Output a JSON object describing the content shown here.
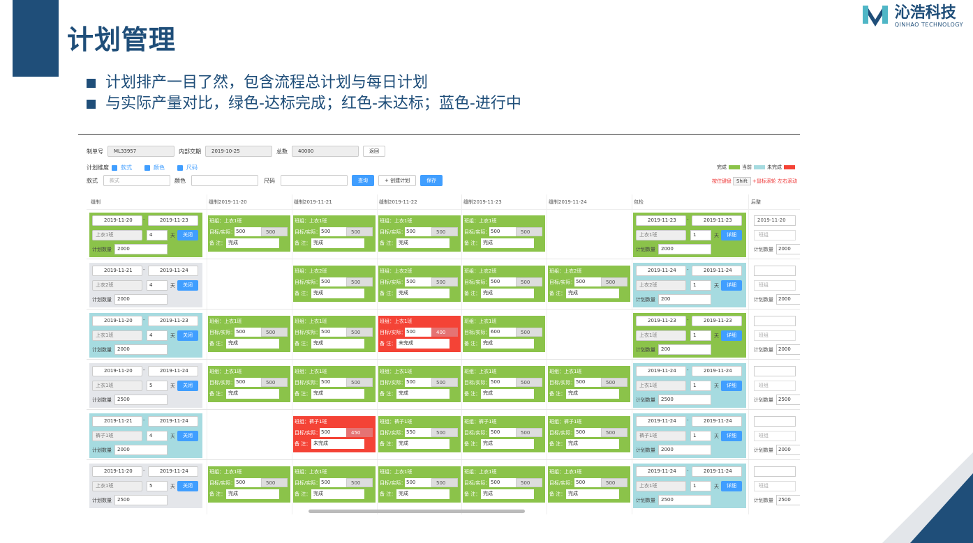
{
  "slide": {
    "title": "计划管理",
    "bullets": [
      "计划排产一目了然，包含流程总计划与每日计划",
      "与实际产量对比，绿色-达标完成；红色-未达标；蓝色-进行中"
    ],
    "logo_cn": "沁浩科技",
    "logo_en": "QINHAO TECHNOLOGY",
    "colors": {
      "brand": "#1f4e79",
      "green": "#8bc34a",
      "red": "#f44336",
      "blue": "#a6dbe0"
    }
  },
  "form": {
    "order_label": "制单号",
    "order_value": "ML33957",
    "delivery_label": "内部交期",
    "delivery_value": "2019-10-25",
    "total_label": "总数",
    "total_value": "40000",
    "back_button": "返回",
    "dim_label": "计划维度",
    "dim_style": "款式",
    "dim_color": "颜色",
    "dim_size": "尺码",
    "style_label": "款式",
    "style_placeholder": "款式",
    "color_label": "颜色",
    "size_label": "尺码",
    "query_button": "查询",
    "create_button": "+ 创建计划",
    "save_button": "保存"
  },
  "legend": {
    "done": "完成",
    "current": "当前",
    "undone": "未完成"
  },
  "hint": {
    "pre": "按住键盘",
    "key": "Shift",
    "post": "+鼠标滚轮 左右滚动"
  },
  "columns": [
    "缝制",
    "缝制2019-11-20",
    "缝制2019-11-21",
    "缝制2019-11-22",
    "缝制2019-11-23",
    "缝制2019-11-24",
    "包检",
    "后整"
  ],
  "labels": {
    "group": "班组：",
    "target": "目标/实际：",
    "note": "备 注：",
    "qty": "计划数量",
    "day": "天",
    "close": "关闭",
    "detail": "详细",
    "dash": "-",
    "back_group": "班组"
  },
  "rows": [
    {
      "sew": {
        "from": "2019-11-20",
        "to": "2019-11-23",
        "group": "上衣1班",
        "days": "4",
        "qty": "2000",
        "color": "g"
      },
      "days": [
        {
          "c": "g",
          "group": "上衣1班",
          "t": "500",
          "a": "500",
          "note": "完成"
        },
        {
          "c": "g",
          "group": "上衣1班",
          "t": "500",
          "a": "500",
          "note": "完成"
        },
        {
          "c": "g",
          "group": "上衣1班",
          "t": "500",
          "a": "500",
          "note": "完成"
        },
        {
          "c": "g",
          "group": "上衣1班",
          "t": "500",
          "a": "500",
          "note": "完成"
        },
        null
      ],
      "pack": {
        "from": "2019-11-23",
        "to": "2019-11-23",
        "group": "上衣1班",
        "days": "1",
        "qty": "2000",
        "color": "g"
      },
      "post": {
        "date": "2019-11-20",
        "qty": "2000"
      }
    },
    {
      "sew": {
        "from": "2019-11-21",
        "to": "2019-11-24",
        "group": "上衣2班",
        "days": "4",
        "qty": "2000",
        "color": "gr"
      },
      "days": [
        null,
        {
          "c": "g",
          "group": "上衣2班",
          "t": "500",
          "a": "500",
          "note": "完成"
        },
        {
          "c": "g",
          "group": "上衣2班",
          "t": "500",
          "a": "500",
          "note": "完成"
        },
        {
          "c": "g",
          "group": "上衣2班",
          "t": "500",
          "a": "500",
          "note": "完成"
        },
        {
          "c": "g",
          "group": "上衣2班",
          "t": "500",
          "a": "500",
          "note": "完成"
        }
      ],
      "pack": {
        "from": "2019-11-24",
        "to": "2019-11-24",
        "group": "上衣2班",
        "days": "1",
        "qty": "200",
        "color": "b"
      },
      "post": {
        "date": "",
        "qty": "2000"
      }
    },
    {
      "sew": {
        "from": "2019-11-20",
        "to": "2019-11-23",
        "group": "上衣1班",
        "days": "4",
        "qty": "2000",
        "color": "b"
      },
      "days": [
        {
          "c": "g",
          "group": "上衣1班",
          "t": "500",
          "a": "500",
          "note": "完成"
        },
        {
          "c": "g",
          "group": "上衣1班",
          "t": "500",
          "a": "500",
          "note": "完成"
        },
        {
          "c": "r",
          "group": "上衣1班",
          "t": "500",
          "a": "400",
          "note": "未完成"
        },
        {
          "c": "g",
          "group": "上衣1班",
          "t": "600",
          "a": "500",
          "note": "完成"
        },
        null
      ],
      "pack": {
        "from": "2019-11-23",
        "to": "2019-11-23",
        "group": "上衣1班",
        "days": "1",
        "qty": "200",
        "color": "g"
      },
      "post": {
        "date": "",
        "qty": "2000"
      }
    },
    {
      "sew": {
        "from": "2019-11-20",
        "to": "2019-11-24",
        "group": "上衣1班",
        "days": "5",
        "qty": "2500",
        "color": "gr"
      },
      "days": [
        {
          "c": "g",
          "group": "上衣1班",
          "t": "500",
          "a": "500",
          "note": "完成"
        },
        {
          "c": "g",
          "group": "上衣1班",
          "t": "500",
          "a": "500",
          "note": "完成"
        },
        {
          "c": "g",
          "group": "上衣1班",
          "t": "500",
          "a": "500",
          "note": "完成"
        },
        {
          "c": "g",
          "group": "上衣1班",
          "t": "500",
          "a": "500",
          "note": "完成"
        },
        {
          "c": "g",
          "group": "上衣1班",
          "t": "500",
          "a": "500",
          "note": "完成"
        }
      ],
      "pack": {
        "from": "2019-11-24",
        "to": "2019-11-24",
        "group": "上衣1班",
        "days": "1",
        "qty": "2500",
        "color": "b"
      },
      "post": {
        "date": "",
        "qty": "2500"
      }
    },
    {
      "sew": {
        "from": "2019-11-21",
        "to": "2019-11-24",
        "group": "裤子1班",
        "days": "4",
        "qty": "2000",
        "color": "b"
      },
      "days": [
        null,
        {
          "c": "r",
          "group": "裤子1班",
          "t": "500",
          "a": "450",
          "note": "未完成"
        },
        {
          "c": "g",
          "group": "裤子1班",
          "t": "550",
          "a": "500",
          "note": "完成"
        },
        {
          "c": "g",
          "group": "裤子1班",
          "t": "500",
          "a": "500",
          "note": "完成"
        },
        {
          "c": "g",
          "group": "裤子1班",
          "t": "500",
          "a": "500",
          "note": "完成"
        }
      ],
      "pack": {
        "from": "2019-11-24",
        "to": "2019-11-24",
        "group": "裤子1班",
        "days": "1",
        "qty": "2000",
        "color": "b"
      },
      "post": {
        "date": "",
        "qty": "2000"
      }
    },
    {
      "sew": {
        "from": "2019-11-20",
        "to": "2019-11-24",
        "group": "上衣1班",
        "days": "5",
        "qty": "2500",
        "color": "gr"
      },
      "days": [
        {
          "c": "g",
          "group": "上衣1班",
          "t": "500",
          "a": "500",
          "note": "完成"
        },
        {
          "c": "g",
          "group": "上衣1班",
          "t": "500",
          "a": "500",
          "note": "完成"
        },
        {
          "c": "g",
          "group": "上衣1班",
          "t": "500",
          "a": "500",
          "note": "完成"
        },
        {
          "c": "g",
          "group": "上衣1班",
          "t": "500",
          "a": "500",
          "note": "完成"
        },
        {
          "c": "g",
          "group": "上衣1班",
          "t": "500",
          "a": "500",
          "note": "完成"
        }
      ],
      "pack": {
        "from": "2019-11-24",
        "to": "2019-11-24",
        "group": "上衣1班",
        "days": "1",
        "qty": "2500",
        "color": "b"
      },
      "post": {
        "date": "",
        "qty": "2500"
      }
    }
  ]
}
